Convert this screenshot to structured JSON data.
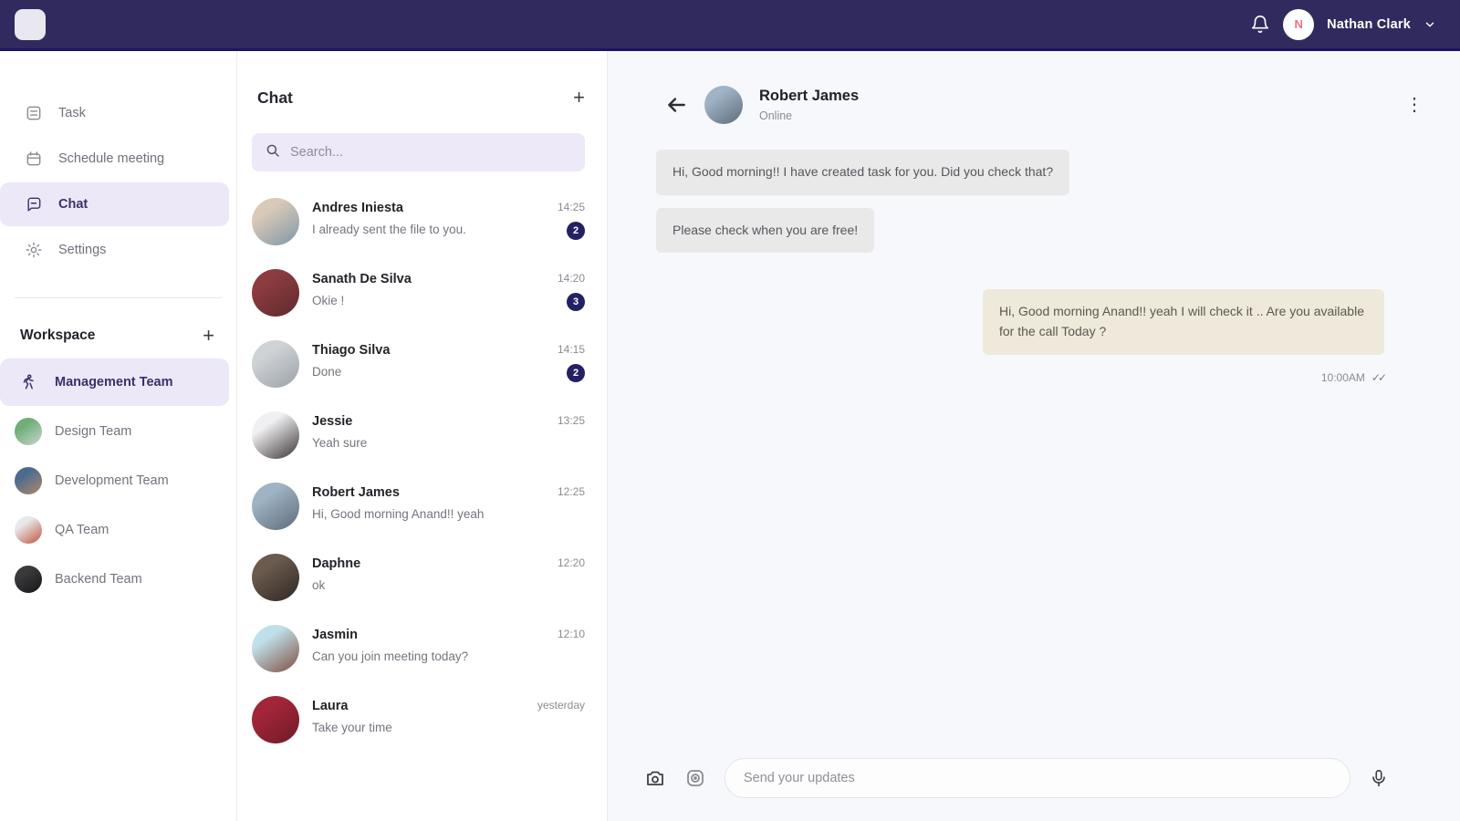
{
  "topbar": {
    "user_name": "Nathan Clark",
    "user_initial": "N"
  },
  "glyphs": {
    "plus": "+",
    "kebab": "⋮",
    "checks": "✓✓"
  },
  "colors": {
    "topbar_bg": "#312a5e",
    "topbar_border": "#1c1566",
    "accent": "#2c2366",
    "selected_bg": "#ece8f8",
    "badge_bg": "#232163",
    "search_bg": "#ede9f8",
    "bubble_in": "#e9e9ea",
    "bubble_out": "#efe9db",
    "main_bg": "#f7f8fb",
    "avatar_initial": "#ef6f80"
  },
  "sidebar": {
    "items": [
      {
        "label": "Task"
      },
      {
        "label": "Schedule meeting"
      },
      {
        "label": "Chat"
      },
      {
        "label": "Settings"
      }
    ],
    "workspace_title": "Workspace",
    "teams": [
      {
        "label": "Management Team"
      },
      {
        "label": "Design Team",
        "avatar_colors": [
          "#6fae76",
          "#c9d4cf"
        ]
      },
      {
        "label": "Development Team",
        "avatar_colors": [
          "#4a6a8f",
          "#b08968"
        ]
      },
      {
        "label": "QA Team",
        "avatar_colors": [
          "#e8e8ea",
          "#c2513f"
        ]
      },
      {
        "label": "Backend Team",
        "avatar_colors": [
          "#3a3a3c",
          "#161617"
        ]
      }
    ]
  },
  "chat_list": {
    "title": "Chat",
    "search_placeholder": "Search...",
    "conversations": [
      {
        "name": "Andres Iniesta",
        "preview": "I already sent the file to you.",
        "time": "14:25",
        "unread": "2",
        "avatar_colors": [
          "#d9c9b8",
          "#7e97a6"
        ]
      },
      {
        "name": "Sanath De Silva",
        "preview": "Okie !",
        "time": "14:20",
        "unread": "3",
        "avatar_colors": [
          "#8c3b3f",
          "#5d2b2e"
        ]
      },
      {
        "name": "Thiago Silva",
        "preview": "Done",
        "time": "14:15",
        "unread": "2",
        "avatar_colors": [
          "#cfd3d6",
          "#9aa1a8"
        ]
      },
      {
        "name": "Jessie",
        "preview": "Yeah sure",
        "time": "13:25",
        "unread": "",
        "avatar_colors": [
          "#f0f0f2",
          "#3a3232"
        ]
      },
      {
        "name": "Robert James",
        "preview": "Hi, Good morning Anand!! yeah",
        "time": "12:25",
        "unread": "",
        "avatar_colors": [
          "#9fb3c4",
          "#5d6b79"
        ]
      },
      {
        "name": "Daphne",
        "preview": "ok",
        "time": "12:20",
        "unread": "",
        "avatar_colors": [
          "#6b5a4e",
          "#2e2823"
        ]
      },
      {
        "name": "Jasmin",
        "preview": "Can you join meeting today?",
        "time": "12:10",
        "unread": "",
        "avatar_colors": [
          "#bfe0ea",
          "#7f4d3e"
        ]
      },
      {
        "name": "Laura",
        "preview": "Take your time",
        "time": "yesterday",
        "unread": "",
        "avatar_colors": [
          "#a32638",
          "#6e1a27"
        ]
      }
    ]
  },
  "conversation": {
    "name": "Robert James",
    "status": "Online",
    "avatar_colors": [
      "#9fb3c4",
      "#5d6b79"
    ],
    "messages": {
      "in1": "Hi, Good morning!! I have created task for you. Did you check that?",
      "in2": "Please check when you are free!",
      "out1": "Hi, Good morning Anand!! yeah I will check it .. Are you available for the call Today ?",
      "out1_time": "10:00AM"
    },
    "composer_placeholder": "Send your updates"
  }
}
